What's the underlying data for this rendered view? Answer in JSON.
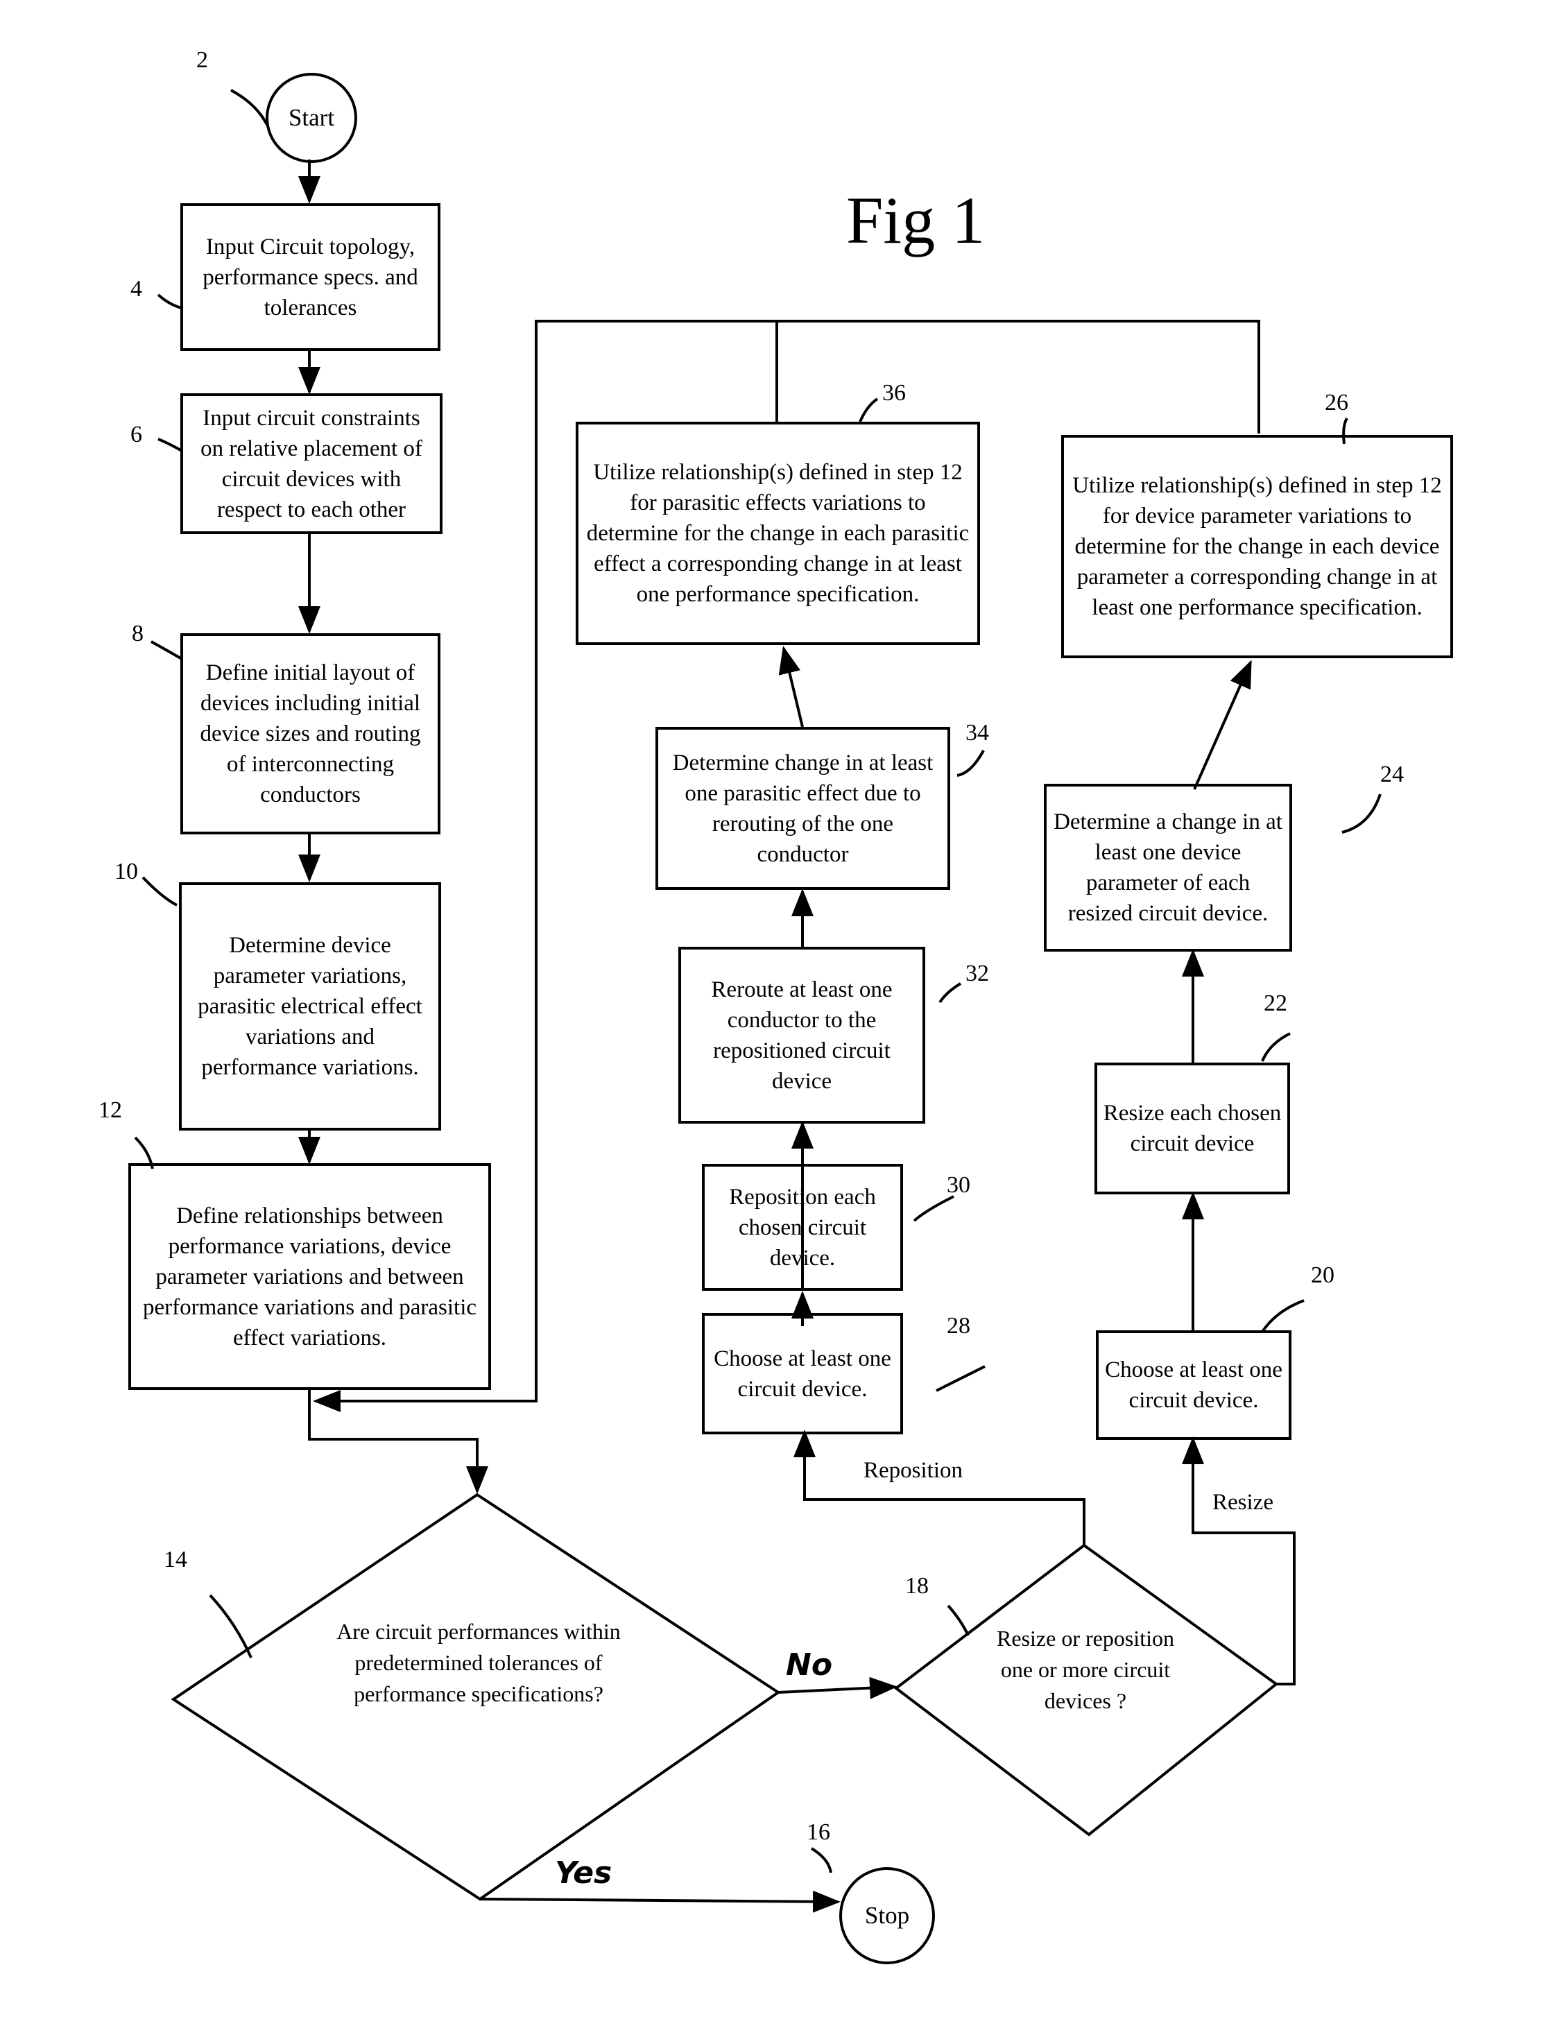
{
  "figure": {
    "title": "Fig 1"
  },
  "terminals": {
    "start": {
      "ref": "2",
      "label": "Start"
    },
    "stop": {
      "ref": "16",
      "label": "Stop"
    }
  },
  "steps": {
    "s4": {
      "ref": "4",
      "text": "Input Circuit topology, performance specs. and tolerances"
    },
    "s6": {
      "ref": "6",
      "text": "Input circuit constraints on relative placement of circuit devices with respect to each other"
    },
    "s8": {
      "ref": "8",
      "text": "Define initial layout of devices including initial device sizes and routing of interconnecting conductors"
    },
    "s10": {
      "ref": "10",
      "text": "Determine device parameter variations, parasitic electrical effect variations and performance variations."
    },
    "s12": {
      "ref": "12",
      "text": "Define relationships between performance variations, device parameter variations and between performance variations and parasitic effect variations."
    },
    "s20": {
      "ref": "20",
      "text": "Choose at least one circuit device."
    },
    "s22": {
      "ref": "22",
      "text": "Resize each chosen circuit device"
    },
    "s24": {
      "ref": "24",
      "text": "Determine a change in at least one device parameter of each resized circuit device."
    },
    "s26": {
      "ref": "26",
      "text": "Utilize relationship(s) defined in step 12 for device parameter variations to determine for the change in each device parameter a corresponding change in at least one performance specification."
    },
    "s28": {
      "ref": "28",
      "text": "Choose at least one circuit device."
    },
    "s30": {
      "ref": "30",
      "text": "Reposition each chosen circuit device."
    },
    "s32": {
      "ref": "32",
      "text": "Reroute at least one conductor to the repositioned circuit device"
    },
    "s34": {
      "ref": "34",
      "text": "Determine change in at least one parasitic effect due to rerouting of the one conductor"
    },
    "s36": {
      "ref": "36",
      "text": "Utilize relationship(s) defined in step 12 for parasitic effects variations to determine for the change in each parasitic effect a corresponding change in at least one performance specification."
    }
  },
  "decisions": {
    "d14": {
      "ref": "14",
      "text": "Are circuit performances within predetermined tolerances of performance specifications?"
    },
    "d18": {
      "ref": "18",
      "text": "Resize or reposition one or more circuit devices ?"
    }
  },
  "edge_labels": {
    "no": "No",
    "yes": "Yes",
    "reposition": "Reposition",
    "resize": "Resize"
  }
}
